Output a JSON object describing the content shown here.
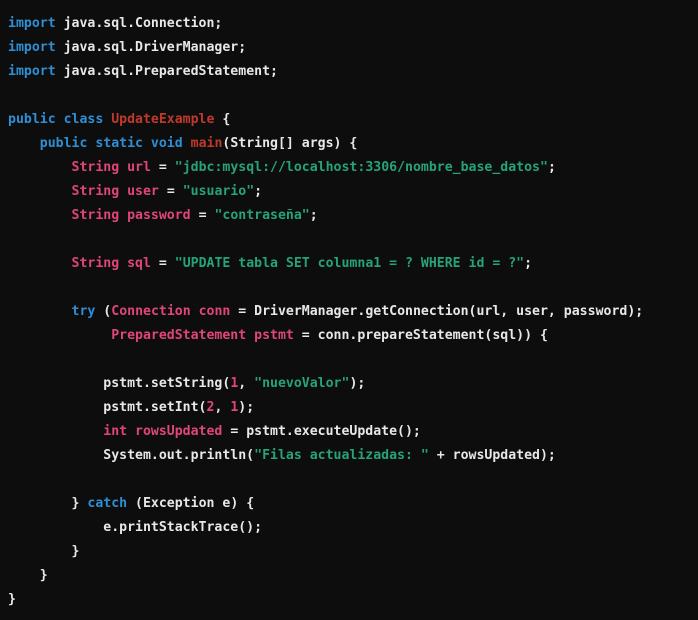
{
  "editor": {
    "language": "Java",
    "background_color": "#0d0d0d",
    "default_text_color": "#e8e8e8",
    "palette": {
      "keyword": "#2f8fd4",
      "type": "#e0457b",
      "class_name": "#c0392b",
      "function": "#c0392b",
      "string": "#26a37a",
      "number": "#e0457b",
      "plain": "#e8e8e8"
    },
    "lines": [
      {
        "n": 1,
        "text": "import java.sql.Connection;",
        "tokens": [
          {
            "t": "import",
            "k": "keyword"
          },
          {
            "t": " java.sql.Connection;",
            "k": "plain"
          }
        ]
      },
      {
        "n": 2,
        "text": "import java.sql.DriverManager;",
        "tokens": [
          {
            "t": "import",
            "k": "keyword"
          },
          {
            "t": " java.sql.DriverManager;",
            "k": "plain"
          }
        ]
      },
      {
        "n": 3,
        "text": "import java.sql.PreparedStatement;",
        "tokens": [
          {
            "t": "import",
            "k": "keyword"
          },
          {
            "t": " java.sql.PreparedStatement;",
            "k": "plain"
          }
        ]
      },
      {
        "n": 4,
        "text": "",
        "tokens": []
      },
      {
        "n": 5,
        "text": "public class UpdateExample {",
        "tokens": [
          {
            "t": "public class ",
            "k": "keyword"
          },
          {
            "t": "UpdateExample",
            "k": "class_name"
          },
          {
            "t": " {",
            "k": "plain"
          }
        ]
      },
      {
        "n": 6,
        "text": "    public static void main(String[] args) {",
        "tokens": [
          {
            "t": "    ",
            "k": "plain"
          },
          {
            "t": "public static void ",
            "k": "keyword"
          },
          {
            "t": "main",
            "k": "function"
          },
          {
            "t": "(String[] args) {",
            "k": "plain"
          }
        ]
      },
      {
        "n": 7,
        "text": "        String url = \"jdbc:mysql://localhost:3306/nombre_base_datos\";",
        "tokens": [
          {
            "t": "        ",
            "k": "plain"
          },
          {
            "t": "String url",
            "k": "type"
          },
          {
            "t": " = ",
            "k": "plain"
          },
          {
            "t": "\"jdbc:mysql://localhost:3306/nombre_base_datos\"",
            "k": "string"
          },
          {
            "t": ";",
            "k": "plain"
          }
        ]
      },
      {
        "n": 8,
        "text": "        String user = \"usuario\";",
        "tokens": [
          {
            "t": "        ",
            "k": "plain"
          },
          {
            "t": "String user",
            "k": "type"
          },
          {
            "t": " = ",
            "k": "plain"
          },
          {
            "t": "\"usuario\"",
            "k": "string"
          },
          {
            "t": ";",
            "k": "plain"
          }
        ]
      },
      {
        "n": 9,
        "text": "        String password = \"contraseña\";",
        "tokens": [
          {
            "t": "        ",
            "k": "plain"
          },
          {
            "t": "String password",
            "k": "type"
          },
          {
            "t": " = ",
            "k": "plain"
          },
          {
            "t": "\"contraseña\"",
            "k": "string"
          },
          {
            "t": ";",
            "k": "plain"
          }
        ]
      },
      {
        "n": 10,
        "text": "",
        "tokens": []
      },
      {
        "n": 11,
        "text": "        String sql = \"UPDATE tabla SET columna1 = ? WHERE id = ?\";",
        "tokens": [
          {
            "t": "        ",
            "k": "plain"
          },
          {
            "t": "String sql",
            "k": "type"
          },
          {
            "t": " = ",
            "k": "plain"
          },
          {
            "t": "\"UPDATE tabla SET columna1 = ? WHERE id = ?\"",
            "k": "string"
          },
          {
            "t": ";",
            "k": "plain"
          }
        ]
      },
      {
        "n": 12,
        "text": "",
        "tokens": []
      },
      {
        "n": 13,
        "text": "        try (Connection conn = DriverManager.getConnection(url, user, password);",
        "tokens": [
          {
            "t": "        ",
            "k": "plain"
          },
          {
            "t": "try",
            "k": "keyword"
          },
          {
            "t": " (",
            "k": "plain"
          },
          {
            "t": "Connection conn",
            "k": "type"
          },
          {
            "t": " = DriverManager.getConnection(url, user, password);",
            "k": "plain"
          }
        ]
      },
      {
        "n": 14,
        "text": "             PreparedStatement pstmt = conn.prepareStatement(sql)) {",
        "tokens": [
          {
            "t": "             ",
            "k": "plain"
          },
          {
            "t": "PreparedStatement pstmt",
            "k": "type"
          },
          {
            "t": " = conn.prepareStatement(sql)) {",
            "k": "plain"
          }
        ]
      },
      {
        "n": 15,
        "text": "",
        "tokens": []
      },
      {
        "n": 16,
        "text": "            pstmt.setString(1, \"nuevoValor\");",
        "tokens": [
          {
            "t": "            pstmt.setString(",
            "k": "plain"
          },
          {
            "t": "1",
            "k": "number"
          },
          {
            "t": ", ",
            "k": "plain"
          },
          {
            "t": "\"nuevoValor\"",
            "k": "string"
          },
          {
            "t": ");",
            "k": "plain"
          }
        ]
      },
      {
        "n": 17,
        "text": "            pstmt.setInt(2, 1);",
        "tokens": [
          {
            "t": "            pstmt.setInt(",
            "k": "plain"
          },
          {
            "t": "2",
            "k": "number"
          },
          {
            "t": ", ",
            "k": "plain"
          },
          {
            "t": "1",
            "k": "number"
          },
          {
            "t": ");",
            "k": "plain"
          }
        ]
      },
      {
        "n": 18,
        "text": "            int rowsUpdated = pstmt.executeUpdate();",
        "tokens": [
          {
            "t": "            ",
            "k": "plain"
          },
          {
            "t": "int rowsUpdated",
            "k": "type"
          },
          {
            "t": " = pstmt.executeUpdate();",
            "k": "plain"
          }
        ]
      },
      {
        "n": 19,
        "text": "            System.out.println(\"Filas actualizadas: \" + rowsUpdated);",
        "tokens": [
          {
            "t": "            System.out.println(",
            "k": "plain"
          },
          {
            "t": "\"Filas actualizadas: \"",
            "k": "string"
          },
          {
            "t": " + rowsUpdated);",
            "k": "plain"
          }
        ]
      },
      {
        "n": 20,
        "text": "",
        "tokens": []
      },
      {
        "n": 21,
        "text": "        } catch (Exception e) {",
        "tokens": [
          {
            "t": "        } ",
            "k": "plain"
          },
          {
            "t": "catch",
            "k": "keyword"
          },
          {
            "t": " (Exception e) {",
            "k": "plain"
          }
        ]
      },
      {
        "n": 22,
        "text": "            e.printStackTrace();",
        "tokens": [
          {
            "t": "            e.printStackTrace();",
            "k": "plain"
          }
        ]
      },
      {
        "n": 23,
        "text": "        }",
        "tokens": [
          {
            "t": "        }",
            "k": "plain"
          }
        ]
      },
      {
        "n": 24,
        "text": "    }",
        "tokens": [
          {
            "t": "    }",
            "k": "plain"
          }
        ]
      },
      {
        "n": 25,
        "text": "}",
        "tokens": [
          {
            "t": "}",
            "k": "plain"
          }
        ]
      }
    ]
  }
}
